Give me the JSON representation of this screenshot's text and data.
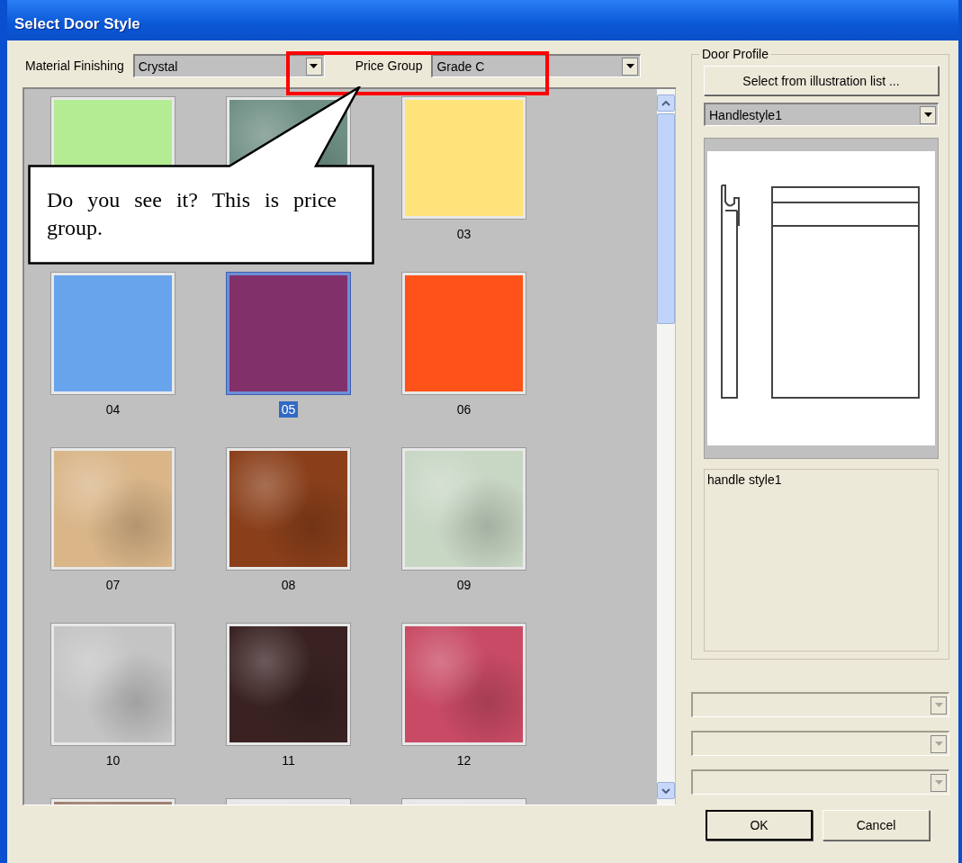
{
  "window": {
    "title": "Select Door Style"
  },
  "filters": [
    {
      "label": "Material Finishing",
      "value": "Crystal"
    },
    {
      "label": "Price Group",
      "value": "Grade C"
    }
  ],
  "swatches": [
    {
      "kind": "solid",
      "color": "#b4ec94",
      "selected": false
    },
    {
      "kind": "texture",
      "color": "#6f8f84",
      "selected": false
    },
    {
      "kind": "solid",
      "color": "#fde37a",
      "label": "03",
      "selected": false
    },
    {
      "kind": "solid",
      "color": "#68a4ec",
      "label": "04",
      "selected": false
    },
    {
      "kind": "solid",
      "color": "#82306a",
      "label": "05",
      "selected": true
    },
    {
      "kind": "solid",
      "color": "#ff5218",
      "label": "06",
      "selected": false
    },
    {
      "kind": "texture",
      "color": "#d9b588",
      "label": "07",
      "selected": false
    },
    {
      "kind": "texture",
      "color": "#8a3f1a",
      "label": "08",
      "selected": false
    },
    {
      "kind": "texture",
      "color": "#c8d6c4",
      "label": "09",
      "selected": false
    },
    {
      "kind": "texture",
      "color": "#c4c4c4",
      "label": "10",
      "selected": false
    },
    {
      "kind": "texture",
      "color": "#3a2222",
      "label": "11",
      "selected": false
    },
    {
      "kind": "texture",
      "color": "#c84a64",
      "label": "12",
      "selected": false
    },
    {
      "kind": "texture",
      "color": "#a08070",
      "selected": false
    },
    {
      "kind": "texture",
      "color": "#e6e6e6",
      "selected": false
    },
    {
      "kind": "texture",
      "color": "#e6e6e6",
      "selected": false
    }
  ],
  "callout": {
    "text": "Do you see it? This is price group."
  },
  "door_profile": {
    "title": "Door Profile",
    "button": "Select from illustration list ...",
    "style": "Handlestyle1",
    "description": "handle style1"
  },
  "extra_dropdowns": [
    {
      "disabled": true
    },
    {
      "disabled": true
    },
    {
      "disabled": true
    }
  ],
  "buttons": [
    {
      "label": "OK",
      "default": true
    },
    {
      "label": "Cancel",
      "default": false
    }
  ]
}
